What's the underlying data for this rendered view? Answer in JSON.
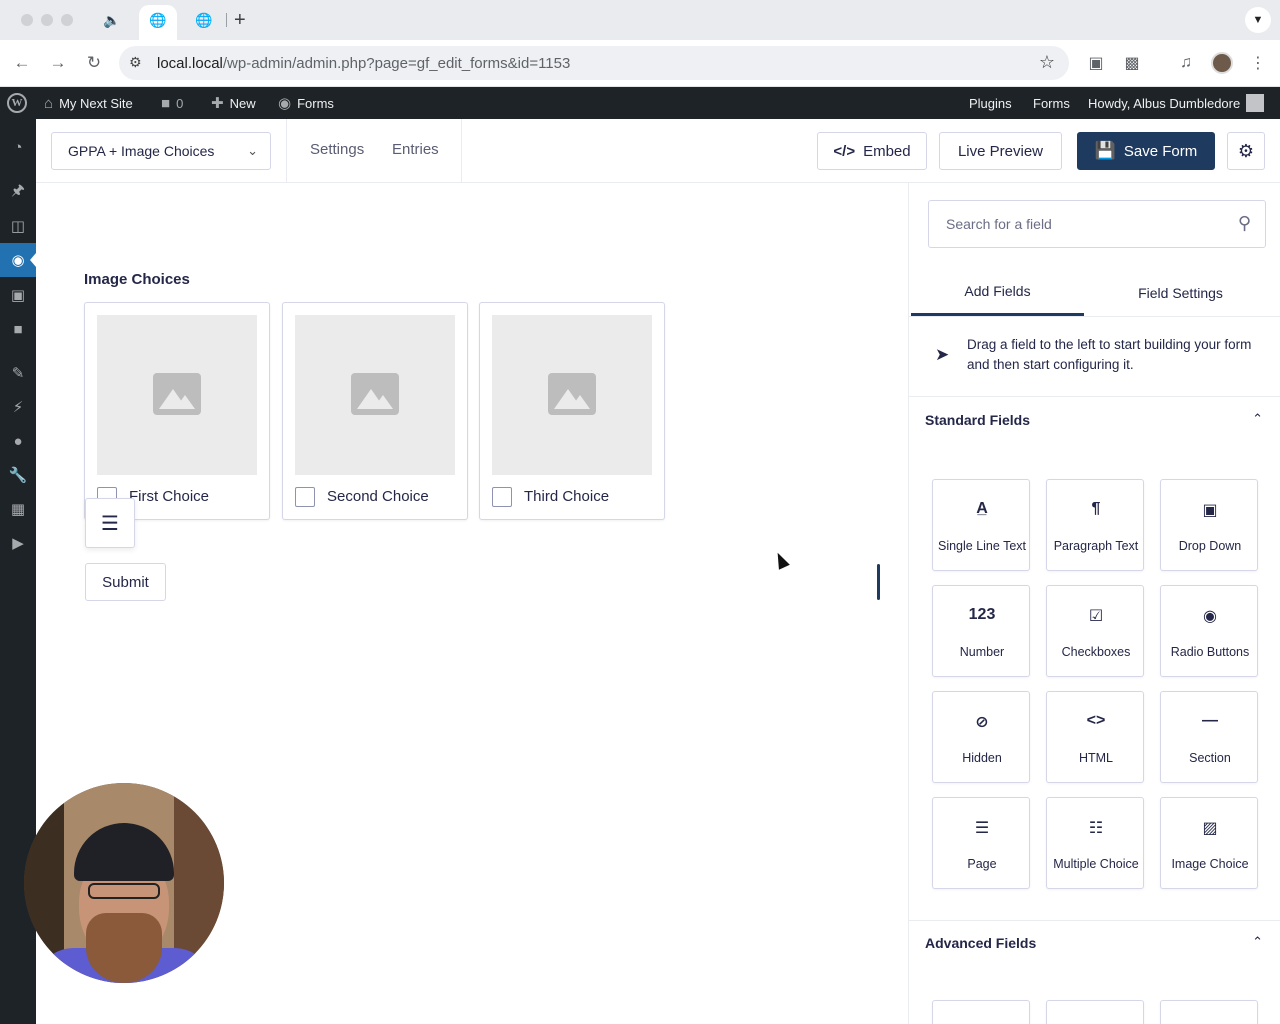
{
  "browser": {
    "url_host": "local.local",
    "url_path": "/wp-admin/admin.php?page=gf_edit_forms&id=1153"
  },
  "wp_admin_bar": {
    "site_name": "My Next Site",
    "comments_count": "0",
    "new_label": "New",
    "forms_label": "Forms",
    "plugins_label": "Plugins",
    "forms_right_label": "Forms",
    "howdy": "Howdy, Albus Dumbledore"
  },
  "editor_header": {
    "form_name": "GPPA + Image Choices",
    "settings_label": "Settings",
    "entries_label": "Entries",
    "embed_label": "Embed",
    "live_preview_label": "Live Preview",
    "save_label": "Save Form"
  },
  "canvas": {
    "field_label": "Image Choices",
    "choices": [
      {
        "label": "First Choice"
      },
      {
        "label": "Second Choice"
      },
      {
        "label": "Third Choice"
      }
    ],
    "submit_label": "Submit"
  },
  "sidebar": {
    "search_placeholder": "Search for a field",
    "tabs": [
      {
        "label": "Add Fields"
      },
      {
        "label": "Field Settings"
      }
    ],
    "hint": "Drag a field to the left to start building your form and then start configuring it.",
    "standard_title": "Standard Fields",
    "advanced_title": "Advanced Fields",
    "standard_fields": [
      {
        "label": "Single Line Text",
        "icon": "A̲"
      },
      {
        "label": "Paragraph Text",
        "icon": "¶"
      },
      {
        "label": "Drop Down",
        "icon": "▣"
      },
      {
        "label": "Number",
        "icon": "123"
      },
      {
        "label": "Checkboxes",
        "icon": "☑"
      },
      {
        "label": "Radio Buttons",
        "icon": "◉"
      },
      {
        "label": "Hidden",
        "icon": "⊘"
      },
      {
        "label": "HTML",
        "icon": "<>"
      },
      {
        "label": "Section",
        "icon": "—"
      },
      {
        "label": "Page",
        "icon": "☰"
      },
      {
        "label": "Multiple Choice",
        "icon": "☷"
      },
      {
        "label": "Image Choice",
        "icon": "▨"
      }
    ]
  },
  "colors": {
    "primary": "#1f3a5f",
    "wp_dark": "#1d2327",
    "wp_active": "#2271b1"
  }
}
